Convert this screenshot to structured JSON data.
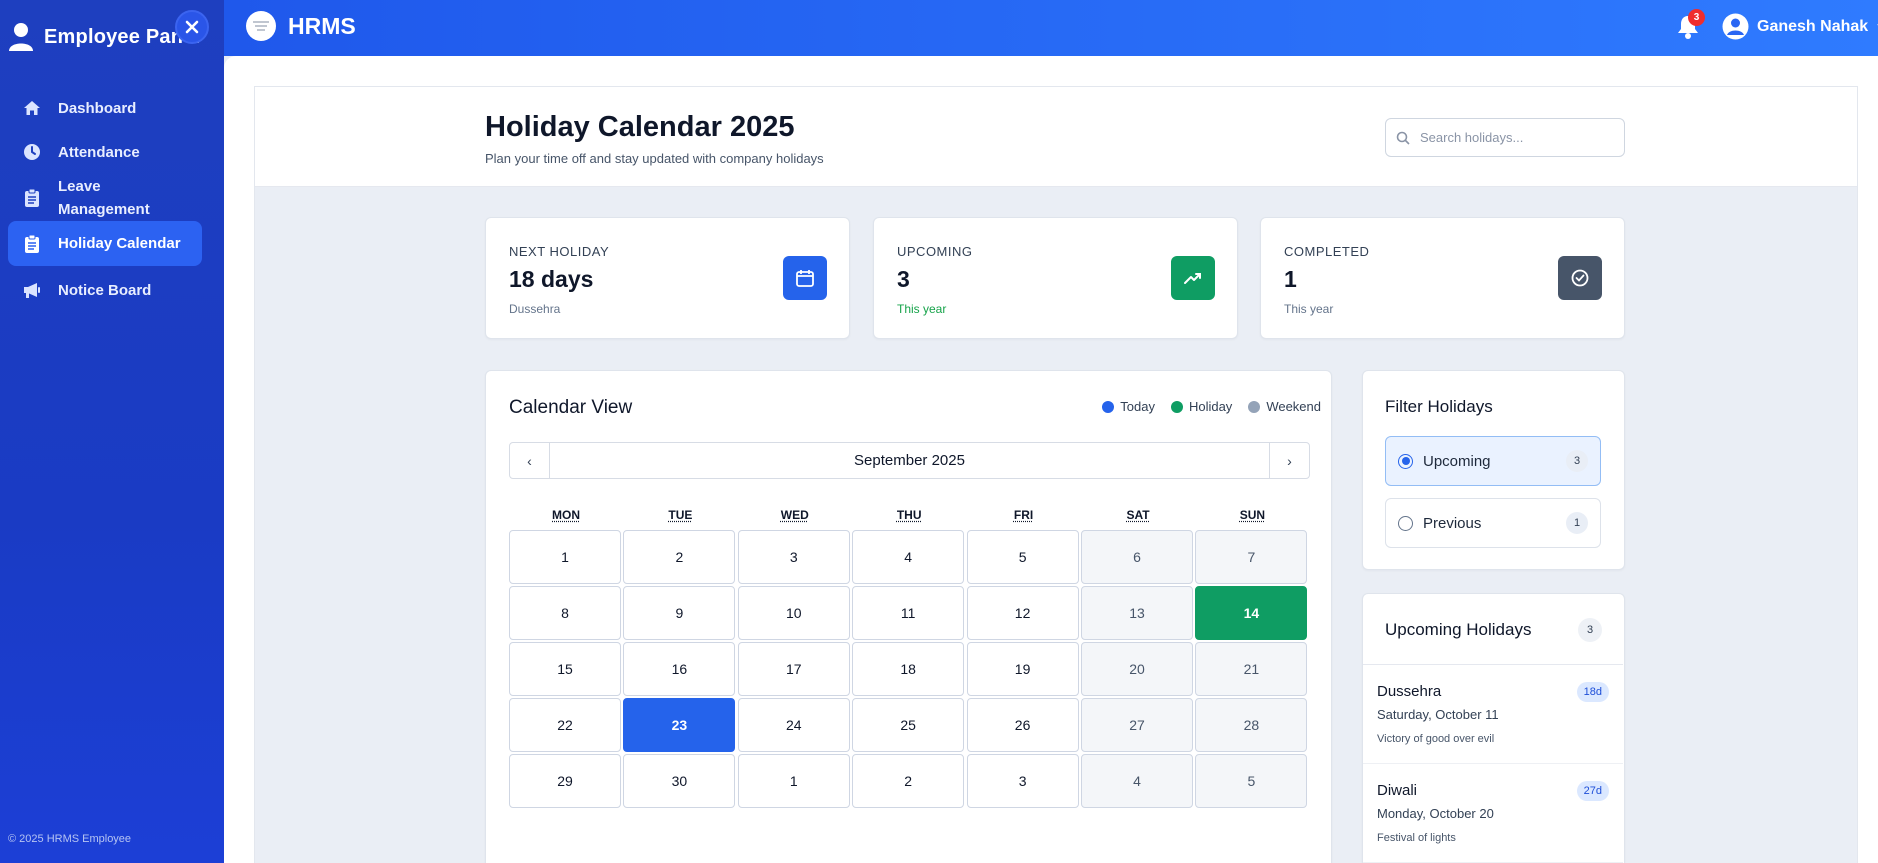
{
  "sidebar": {
    "title": "Employee Panel",
    "items": [
      {
        "label": "Dashboard",
        "icon": "home-icon"
      },
      {
        "label": "Attendance",
        "icon": "clock-icon"
      },
      {
        "label": "Leave\nManagement",
        "icon": "clipboard-icon"
      },
      {
        "label": "Holiday Calendar",
        "icon": "clipboard-icon",
        "active": true
      },
      {
        "label": "Notice Board",
        "icon": "megaphone-icon"
      }
    ],
    "footer": "© 2025 HRMS Employee"
  },
  "topbar": {
    "brand": "HRMS",
    "notification_count": "3",
    "user_name": "Ganesh Nahak"
  },
  "header": {
    "title": "Holiday Calendar 2025",
    "subtitle": "Plan your time off and stay updated with company holidays",
    "search_placeholder": "Search holidays..."
  },
  "stats": [
    {
      "label": "NEXT HOLIDAY",
      "value": "18 days",
      "sub": "Dussehra",
      "color": "#2563eb",
      "icon": "calendar-icon"
    },
    {
      "label": "UPCOMING",
      "value": "3",
      "sub": "This year",
      "color": "#0f9d63",
      "icon": "trending-up-icon"
    },
    {
      "label": "COMPLETED",
      "value": "1",
      "sub": "This year",
      "color": "#475569",
      "icon": "check-circle-icon"
    }
  ],
  "calendar": {
    "title": "Calendar View",
    "legend": [
      {
        "label": "Today",
        "color": "#2563eb"
      },
      {
        "label": "Holiday",
        "color": "#0f9d63"
      },
      {
        "label": "Weekend",
        "color": "#94a3b8"
      }
    ],
    "month": "September 2025",
    "prev": "‹",
    "next": "›",
    "weekdays": [
      "MON",
      "TUE",
      "WED",
      "THU",
      "FRI",
      "SAT",
      "SUN"
    ],
    "weeks": [
      [
        "1",
        "2",
        "3",
        "4",
        "5",
        "6",
        "7"
      ],
      [
        "8",
        "9",
        "10",
        "11",
        "12",
        "13",
        "14"
      ],
      [
        "15",
        "16",
        "17",
        "18",
        "19",
        "20",
        "21"
      ],
      [
        "22",
        "23",
        "24",
        "25",
        "26",
        "27",
        "28"
      ],
      [
        "29",
        "30",
        "1",
        "2",
        "3",
        "4",
        "5"
      ]
    ],
    "today": "23",
    "holiday": "14"
  },
  "filter": {
    "title": "Filter Holidays",
    "options": [
      {
        "label": "Upcoming",
        "count": "3",
        "selected": true
      },
      {
        "label": "Previous",
        "count": "1",
        "selected": false
      }
    ]
  },
  "upcoming": {
    "title": "Upcoming Holidays",
    "count": "3",
    "items": [
      {
        "name": "Dussehra",
        "date": "Saturday, October 11",
        "desc": "Victory of good over evil",
        "days": "18d"
      },
      {
        "name": "Diwali",
        "date": "Monday, October 20",
        "desc": "Festival of lights",
        "days": "27d"
      }
    ]
  }
}
